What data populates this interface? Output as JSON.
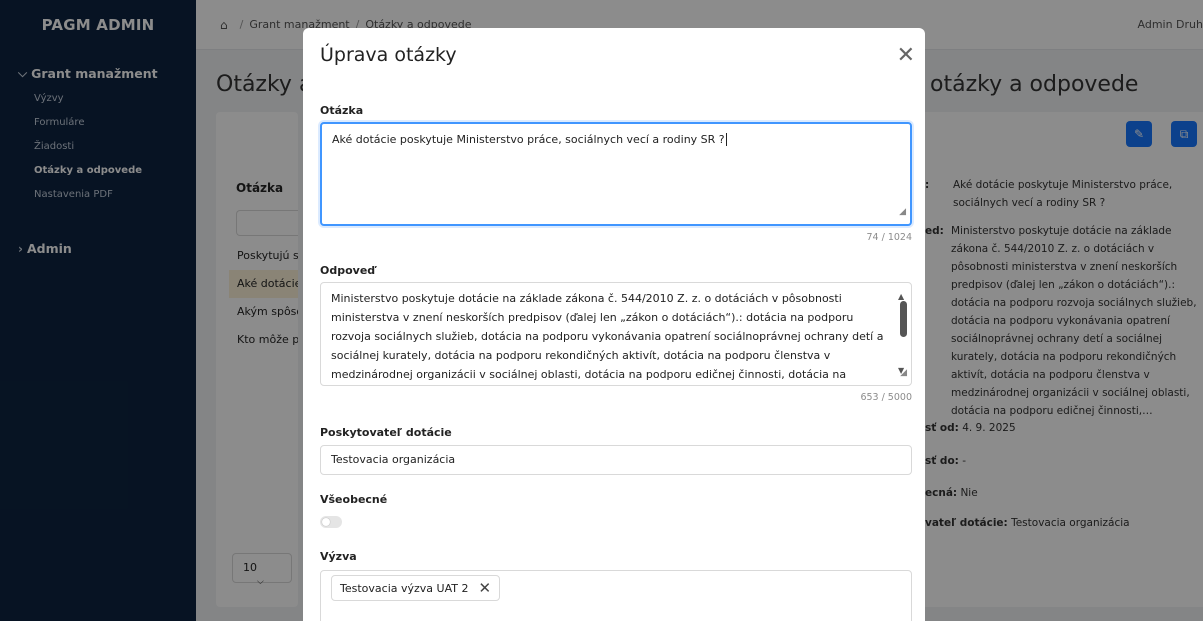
{
  "sidebar": {
    "brand": "PAGM ADMIN",
    "groups": [
      {
        "label": "Grant manažment",
        "items": [
          "Výzvy",
          "Formuláre",
          "Žiadosti",
          "Otázky a odpovede",
          "Nastavenia PDF"
        ],
        "active": "Otázky a odpovede"
      },
      {
        "label": "Admin"
      }
    ]
  },
  "header": {
    "breadcrumb": [
      "Grant manažment",
      "Otázky a odpovede"
    ],
    "user": "Admin Druh"
  },
  "background": {
    "title_left": "Otázky a c",
    "title_right": "otázky a odpovede",
    "column_header": "Otázka",
    "rows": [
      "Poskytujú sa d",
      "Aké dotácie po",
      "Akým spôsobo",
      "Kto môže poži"
    ],
    "page_size": "10",
    "detail": {
      "question_label": ":",
      "question_value": "Aké dotácie poskytuje Ministerstvo práce, sociálnych vecí a rodiny SR ?",
      "answer_label": "ed:",
      "answer_value": "Ministerstvo poskytuje dotácie na základe zákona č. 544/2010 Z. z. o dotáciách v pôsobnosti ministerstva v znení neskorších predpisov (ďalej len „zákon o dotáciách“).: dotácia na podporu rozvoja sociálnych služieb, dotácia na podporu vykonávania opatrení sociálnoprávnej ochrany detí a sociálnej kurately, dotácia na podporu rekondičných aktivít, dotácia na podporu členstva v medzinárodnej organizácii v sociálnej oblasti, dotácia na podporu edičnej činnosti,…",
      "valid_from_label": "sť od:",
      "valid_from_value": "4. 9. 2025",
      "valid_to_label": "sť do:",
      "valid_to_value": "-",
      "general_label": "ecná:",
      "general_value": "Nie",
      "provider_label": "vateľ dotácie:",
      "provider_value": "Testovacia organizácia"
    }
  },
  "modal": {
    "title": "Úprava otázky",
    "question_label": "Otázka",
    "question_value": "Aké dotácie poskytuje Ministerstvo práce, sociálnych vecí a rodiny SR ?",
    "question_counter": "74 / 1024",
    "answer_label": "Odpoveď",
    "answer_value": "Ministerstvo poskytuje dotácie na základe zákona č. 544/2010 Z. z. o dotáciách v pôsobnosti ministerstva v znení neskorších predpisov (ďalej len „zákon o dotáciách“).: dotácia na podporu rozvoja sociálnych služieb, dotácia na podporu vykonávania opatrení sociálnoprávnej ochrany detí a sociálnej kurately, dotácia na podporu rekondičných aktivít, dotácia na podporu členstva v medzinárodnej organizácii v sociálnej oblasti, dotácia na podporu edičnej činnosti, dotácia na podporu humanitárnej pomoci, dotácia na podporu",
    "answer_counter": "653 / 5000",
    "provider_label": "Poskytovateľ dotácie",
    "provider_value": "Testovacia organizácia",
    "general_label": "Všeobecné",
    "general_on": false,
    "call_label": "Výzva",
    "call_tags": [
      "Testovacia výzva UAT 2"
    ]
  }
}
